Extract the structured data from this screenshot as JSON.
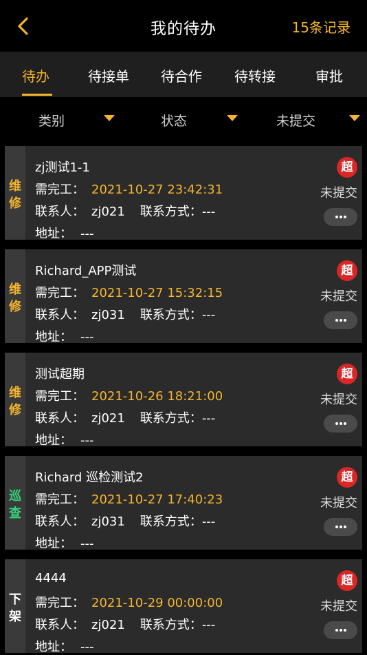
{
  "header": {
    "title": "我的待办",
    "records": "15条记录",
    "back_icon": "chevron-left-icon"
  },
  "tabs": [
    {
      "label": "待办",
      "active": true
    },
    {
      "label": "待接单",
      "active": false
    },
    {
      "label": "待合作",
      "active": false
    },
    {
      "label": "待转接",
      "active": false
    },
    {
      "label": "审批",
      "active": false
    }
  ],
  "filters": [
    {
      "label": "类别",
      "icon": "caret-down-icon"
    },
    {
      "label": "状态",
      "icon": "caret-down-icon"
    },
    {
      "label": "未提交",
      "icon": "caret-down-icon"
    }
  ],
  "labels": {
    "due": "需完工：",
    "contact": "联系人：",
    "phone": "联系方式：",
    "address": "地址："
  },
  "colors": {
    "accent": "#f5b52e",
    "overdue_badge": "#d92626",
    "inspection": "#37d67a"
  },
  "tasks": [
    {
      "category": "维修",
      "title": "zj测试1-1",
      "due": "2021-10-27 23:42:31",
      "contact": "zj021",
      "phone": "---",
      "address": "---",
      "badge": "超",
      "status": "未提交"
    },
    {
      "category": "维修",
      "title": "Richard_APP测试",
      "due": "2021-10-27 15:32:15",
      "contact": "zj031",
      "phone": "---",
      "address": "---",
      "badge": "超",
      "status": "未提交"
    },
    {
      "category": "维修",
      "title": "测试超期",
      "due": "2021-10-26 18:21:00",
      "contact": "zj021",
      "phone": "---",
      "address": "---",
      "badge": "超",
      "status": "未提交"
    },
    {
      "category": "巡查",
      "title": "Richard 巡检测试2",
      "due": "2021-10-27 17:40:23",
      "contact": "zj031",
      "phone": "---",
      "address": "---",
      "badge": "超",
      "status": "未提交"
    },
    {
      "category": "下架",
      "title": "4444",
      "due": "2021-10-29 00:00:00",
      "contact": "zj021",
      "phone": "---",
      "address": "---",
      "badge": "超",
      "status": "未提交"
    }
  ]
}
